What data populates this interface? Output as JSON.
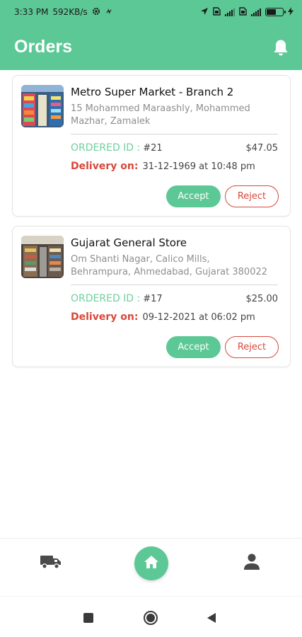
{
  "status_bar": {
    "time": "3:33 PM",
    "speed": "592KB/s",
    "battery_level": 0.6,
    "icons": [
      "settings-gear-icon",
      "sync-icon",
      "location-arrow-icon",
      "sim-icon",
      "signal-icon",
      "sim-icon",
      "signal-icon",
      "battery-icon",
      "charging-icon"
    ]
  },
  "app_bar": {
    "title": "Orders",
    "icon": "bell-icon"
  },
  "colors": {
    "primary": "#5cc895",
    "order_id_label": "#6fcfa0",
    "delivery_label": "#d8483c",
    "reject": "#d8483c"
  },
  "orders": [
    {
      "store_name": "Metro Super Market - Branch 2",
      "address": "15 Mohammed Maraashly, Mohammed Mazhar, Zamalek",
      "order_id_label": "ORDERED ID :",
      "order_id": "#21",
      "price": "$47.05",
      "delivery_label": "Delivery on:",
      "delivery_datetime": "31-12-1969 at 10:48 pm",
      "accept_label": "Accept",
      "reject_label": "Reject"
    },
    {
      "store_name": "Gujarat General Store",
      "address": "Om Shanti Nagar, Calico Mills, Behrampura, Ahmedabad, Gujarat 380022",
      "order_id_label": "ORDERED ID :",
      "order_id": "#17",
      "price": "$25.00",
      "delivery_label": "Delivery on:",
      "delivery_datetime": "09-12-2021 at 06:02 pm",
      "accept_label": "Accept",
      "reject_label": "Reject"
    }
  ],
  "bottom_nav": {
    "items": [
      "truck-icon",
      "home-icon",
      "profile-icon"
    ],
    "active": "home-icon"
  },
  "system_nav": {
    "items": [
      "recents-button",
      "home-button",
      "back-button"
    ]
  }
}
